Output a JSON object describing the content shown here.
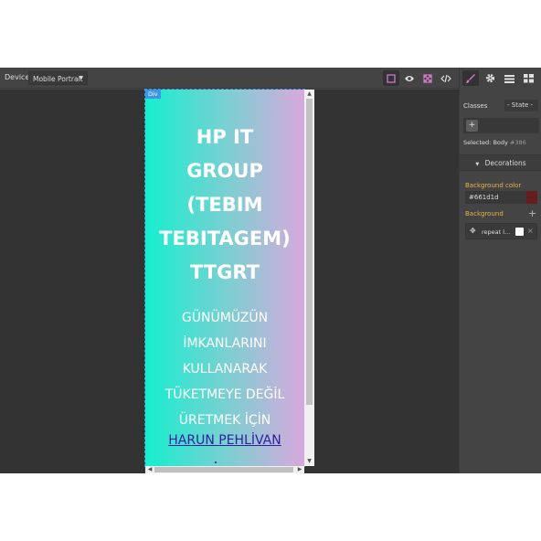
{
  "toolbar": {
    "device_label": "Device",
    "device_value": "Mobile Portrait",
    "icons": [
      "sw-visibility-icon",
      "preview-icon",
      "fullscreen-icon",
      "code-icon"
    ]
  },
  "panel": {
    "tabs": [
      "style-manager-icon",
      "settings-icon",
      "layers-icon",
      "blocks-icon"
    ],
    "classes_label": "Classes",
    "state_label": "- State -",
    "add_class": "+",
    "selected_label": "Selected:",
    "selected_name": "Body",
    "selected_id": "#386",
    "sector_title": "Decorations",
    "bg_color_label": "Background color",
    "bg_color_value": "#661d1d",
    "bg_color_swatch": "#661d1d",
    "bg_label": "Background",
    "bg_add": "+",
    "bg_layer_value": "repeat l...",
    "bg_layer_remove": "×"
  },
  "canvas": {
    "badge": "Div",
    "title_lines": [
      "HP IT",
      "GROUP",
      "(TEBIM",
      "TEBITAGEM)",
      "TTGRT"
    ],
    "subtitle_lines": [
      "GÜNÜMÜZÜN",
      "İMKANLARINI",
      "KULLANARAK",
      "TÜKETMEYE DEĞİL",
      "ÜRETMEK İÇİN"
    ],
    "link_text": "HARUN PEHLİVAN"
  },
  "colors": {
    "accent": "#3b97e3",
    "label_orange": "#e7b44a",
    "active_tool": "#d278c9",
    "link": "#2f1fa0"
  }
}
